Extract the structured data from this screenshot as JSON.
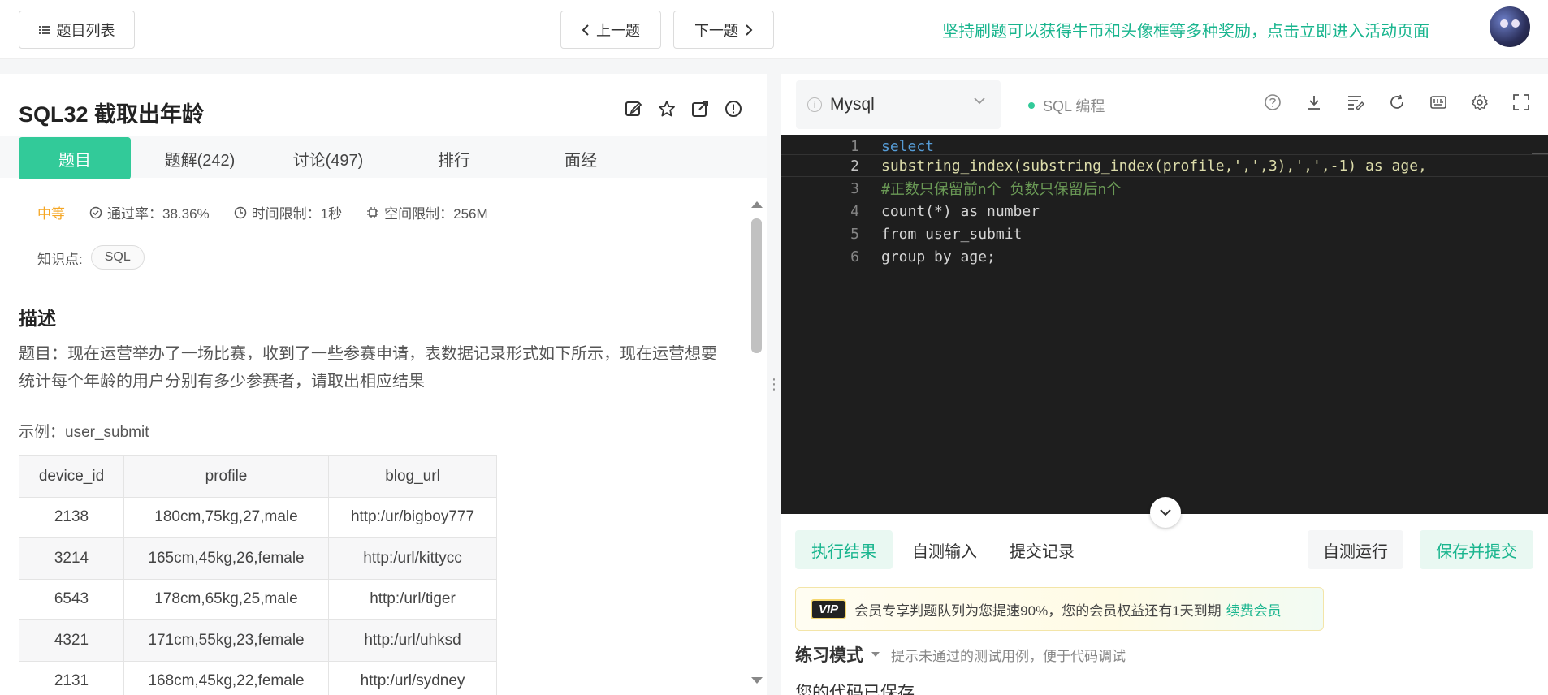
{
  "topbar": {
    "list_label": "题目列表",
    "prev_label": "上一题",
    "next_label": "下一题",
    "promo": "坚持刷题可以获得牛币和头像框等多种奖励，点击立即进入活动页面"
  },
  "question": {
    "title": "SQL32  截取出年龄",
    "tabs": [
      "题目",
      "题解(242)",
      "讨论(497)",
      "排行",
      "面经"
    ],
    "difficulty": "中等",
    "pass_rate": "通过率：38.36%",
    "time_limit": "时间限制：1秒",
    "space_limit": "空间限制：256M",
    "knowledge_label": "知识点:",
    "knowledge_tag": "SQL",
    "desc_heading": "描述",
    "desc_text": "题目：现在运营举办了一场比赛，收到了一些参赛申请，表数据记录形式如下所示，现在运营想要统计每个年龄的用户分别有多少参赛者，请取出相应结果",
    "example_label": "示例：user_submit",
    "table": {
      "headers": [
        "device_id",
        "profile",
        "blog_url"
      ],
      "rows": [
        [
          "2138",
          "180cm,75kg,27,male",
          "http:/ur/bigboy777"
        ],
        [
          "3214",
          "165cm,45kg,26,female",
          "http:/url/kittycc"
        ],
        [
          "6543",
          "178cm,65kg,25,male",
          "http:/url/tiger"
        ],
        [
          "4321",
          "171cm,55kg,23,female",
          "http:/url/uhksd"
        ],
        [
          "2131",
          "168cm,45kg,22,female",
          "http:/url/sydney"
        ]
      ]
    }
  },
  "editor": {
    "language": "Mysql",
    "mode": "SQL 编程",
    "line_numbers": [
      "1",
      "2",
      "3",
      "4",
      "5",
      "6"
    ],
    "code": [
      "select",
      "substring_index(substring_index(profile,',',3),',',-1) as age,",
      "#正数只保留前n个 负数只保留后n个",
      "count(*) as number",
      "from user_submit",
      "group by age;"
    ]
  },
  "result": {
    "tabs": [
      "执行结果",
      "自测输入",
      "提交记录"
    ],
    "run_label": "自测运行",
    "submit_label": "保存并提交",
    "vip_badge": "VIP",
    "vip_text": "会员专享判题队列为您提速90%，您的会员权益还有1天到期",
    "vip_renew": "续费会员",
    "practice_mode": "练习模式",
    "practice_hint": "提示未通过的测试用例，便于代码调试",
    "saved_text": "您的代码已保存"
  },
  "colors": {
    "accent": "#32ca99",
    "promo": "#19b58e",
    "difficulty": "#f5a623",
    "editor_bg": "#1e1e1e"
  }
}
